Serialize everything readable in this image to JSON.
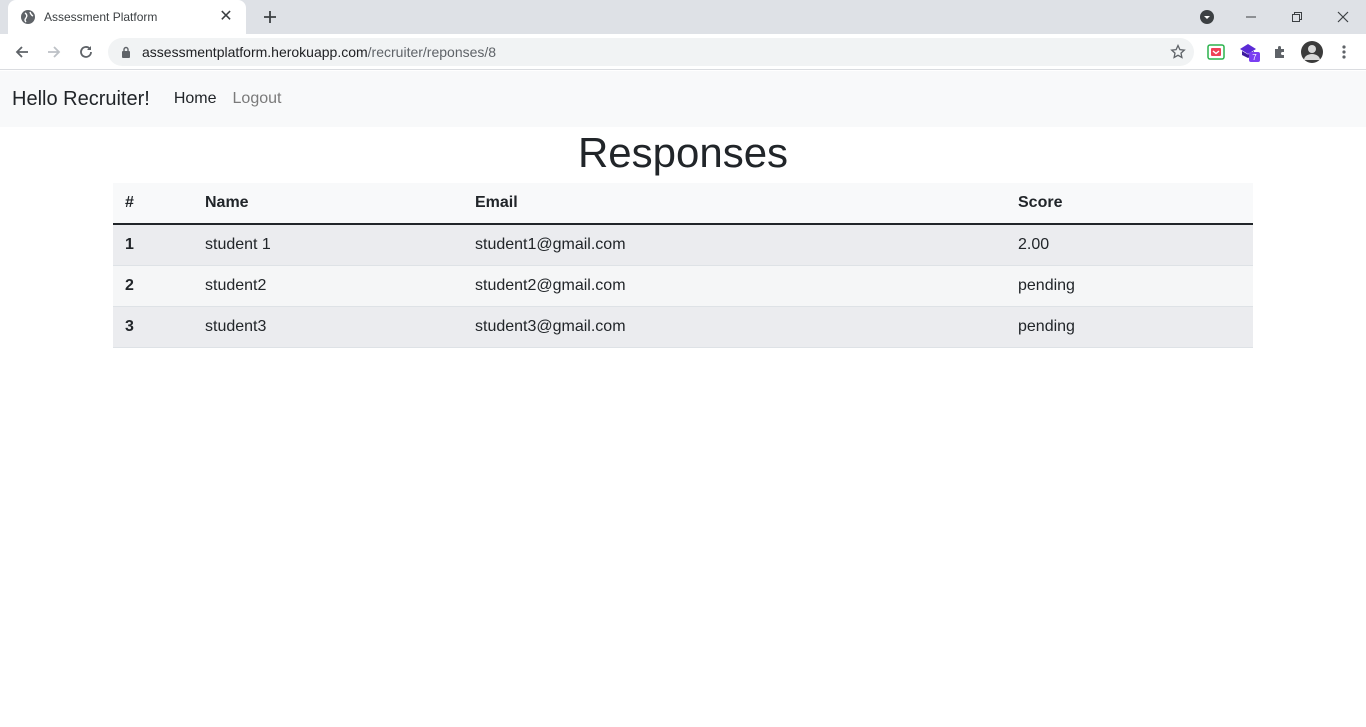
{
  "browser": {
    "tab_title": "Assessment Platform",
    "url_host": "assessmentplatform.herokuapp.com",
    "url_path": "/recruiter/reponses/8",
    "extension_badge": "7"
  },
  "navbar": {
    "brand": "Hello Recruiter!",
    "home": "Home",
    "logout": "Logout"
  },
  "page": {
    "title": "Responses"
  },
  "table": {
    "headers": [
      "#",
      "Name",
      "Email",
      "Score"
    ],
    "rows": [
      {
        "num": "1",
        "name": "student 1",
        "email": "student1@gmail.com",
        "score": "2.00"
      },
      {
        "num": "2",
        "name": "student2",
        "email": "student2@gmail.com",
        "score": "pending"
      },
      {
        "num": "3",
        "name": "student3",
        "email": "student3@gmail.com",
        "score": "pending"
      }
    ]
  },
  "colors": {
    "navbar_bg": "#f8f9fa",
    "tabstrip_bg": "#dee1e6",
    "extension_purple": "#5b2bd6"
  }
}
